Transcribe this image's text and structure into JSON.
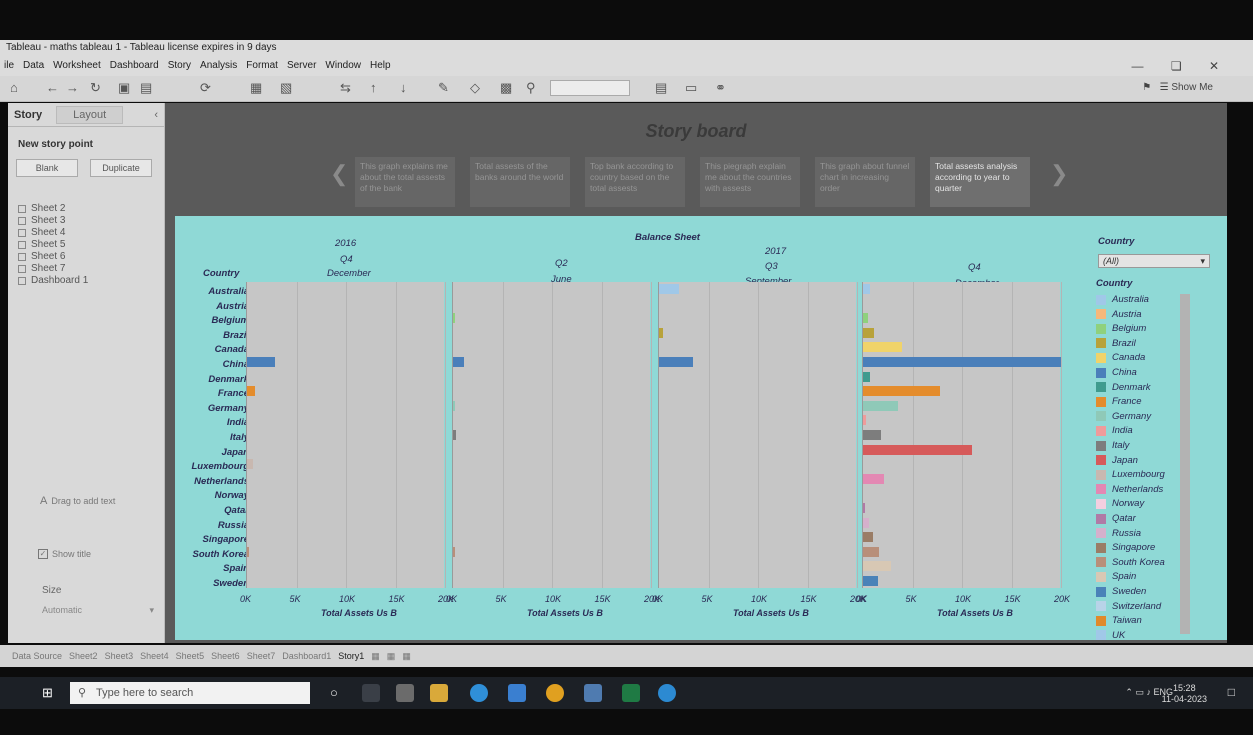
{
  "window": {
    "title": "Tableau - maths tableau 1 - Tableau license expires in 9 days"
  },
  "menu": [
    "ile",
    "Data",
    "Worksheet",
    "Dashboard",
    "Story",
    "Analysis",
    "Format",
    "Server",
    "Window",
    "Help"
  ],
  "toolbar": {
    "show_me": "Show Me"
  },
  "left_panel": {
    "tabs": [
      "Story",
      "Layout"
    ],
    "new_story_point": "New story point",
    "blank": "Blank",
    "duplicate": "Duplicate",
    "sheets": [
      "Sheet 2",
      "Sheet 3",
      "Sheet 4",
      "Sheet 5",
      "Sheet 6",
      "Sheet 7",
      "Dashboard 1"
    ],
    "drag_text": "Drag to add text",
    "show_title": "Show title",
    "size_label": "Size",
    "size_value": "Automatic"
  },
  "story": {
    "title": "Story board",
    "points": [
      "This graph explains me about the total assests of the bank",
      "Total assests of the banks around the world",
      "Top bank according to country based on the total assests",
      "This piegraph explain me about the countries with assests",
      "This graph about funnel chart in increasing order",
      "Total assests analysis according to year to quarter"
    ]
  },
  "chart_data": {
    "type": "bar",
    "title": "Balance Sheet",
    "row_field": "Country",
    "x_axis_title": "Total Assets Us B",
    "x_ticks": [
      "0K",
      "5K",
      "10K",
      "15K",
      "20K"
    ],
    "xlim": [
      0,
      20000
    ],
    "panels": [
      {
        "year": "2016",
        "quarter": "Q4",
        "month": "December",
        "values": {
          "China": 2800,
          "France": 800,
          "Luxembourg": 600,
          "South Korea": 200
        }
      },
      {
        "year": "",
        "quarter": "Q2",
        "month": "June",
        "values": {
          "Belgium": 150,
          "China": 1100,
          "Germany": 150,
          "Italy": 300,
          "South Korea": 200
        }
      },
      {
        "year": "2017",
        "quarter": "Q3",
        "month": "September",
        "values": {
          "Australia": 2000,
          "Brazil": 400,
          "China": 3400
        }
      },
      {
        "year": "",
        "quarter": "Q4",
        "month": "December",
        "values": {
          "Australia": 700,
          "Belgium": 500,
          "Brazil": 1100,
          "Canada": 3900,
          "China": 20000,
          "Denmark": 700,
          "France": 7800,
          "Germany": 3500,
          "India": 300,
          "Italy": 1800,
          "Japan": 11000,
          "Netherlands": 2100,
          "Qatar": 200,
          "Russia": 600,
          "Singapore": 1000,
          "South Korea": 1600,
          "Spain": 2800,
          "Sweden": 1500
        }
      }
    ],
    "countries": [
      "Australia",
      "Austria",
      "Belgium",
      "Brazil",
      "Canada",
      "China",
      "Denmark",
      "France",
      "Germany",
      "India",
      "Italy",
      "Japan",
      "Luxembourg",
      "Netherlands",
      "Norway",
      "Qatar",
      "Russia",
      "Singapore",
      "South Korea",
      "Spain",
      "Sweden"
    ]
  },
  "legend": {
    "filter_label": "Country",
    "filter_value": "(All)",
    "title": "Country",
    "items": [
      {
        "name": "Australia",
        "color": "#a0c8e8"
      },
      {
        "name": "Austria",
        "color": "#f5b87a"
      },
      {
        "name": "Belgium",
        "color": "#8fd17d"
      },
      {
        "name": "Brazil",
        "color": "#b8a23a"
      },
      {
        "name": "Canada",
        "color": "#f0d36a"
      },
      {
        "name": "China",
        "color": "#4a7fba"
      },
      {
        "name": "Denmark",
        "color": "#3f9b8e"
      },
      {
        "name": "France",
        "color": "#e48c2c"
      },
      {
        "name": "Germany",
        "color": "#8fc9b8"
      },
      {
        "name": "India",
        "color": "#ef9b9b"
      },
      {
        "name": "Italy",
        "color": "#7d7d7d"
      },
      {
        "name": "Japan",
        "color": "#d65a5a"
      },
      {
        "name": "Luxembourg",
        "color": "#c8b8b0"
      },
      {
        "name": "Netherlands",
        "color": "#e388b3"
      },
      {
        "name": "Norway",
        "color": "#f3cfe0"
      },
      {
        "name": "Qatar",
        "color": "#b07aa6"
      },
      {
        "name": "Russia",
        "color": "#d5b0cc"
      },
      {
        "name": "Singapore",
        "color": "#9a7d66"
      },
      {
        "name": "South Korea",
        "color": "#b88f7a"
      },
      {
        "name": "Spain",
        "color": "#d8c8b4"
      },
      {
        "name": "Sweden",
        "color": "#4a82b8"
      },
      {
        "name": "Switzerland",
        "color": "#b8d3e8"
      },
      {
        "name": "Taiwan",
        "color": "#e08a2a"
      },
      {
        "name": "UK",
        "color": "#a0c8e8"
      }
    ]
  },
  "bottom_tabs": [
    "Data Source",
    "Sheet2",
    "Sheet3",
    "Sheet4",
    "Sheet5",
    "Sheet6",
    "Sheet7",
    "Dashboard1",
    "Story1"
  ],
  "taskbar": {
    "search_placeholder": "Type here to search",
    "lang": "ENG",
    "time": "15:28",
    "date": "11-04-2023"
  }
}
